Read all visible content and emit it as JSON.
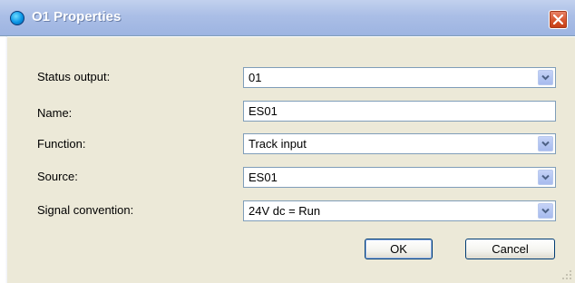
{
  "window": {
    "title": "O1 Properties",
    "icon": "blue-orb-icon",
    "close_icon": "close-icon"
  },
  "form": {
    "rows": [
      {
        "label": "Status output:",
        "value": "01",
        "control": "dropdown"
      },
      {
        "label": "Name:",
        "value": "ES01",
        "control": "textbox"
      },
      {
        "label": "Function:",
        "value": "Track input",
        "control": "dropdown"
      },
      {
        "label": "Source:",
        "value": "ES01",
        "control": "dropdown"
      },
      {
        "label": "Signal convention:",
        "value": "24V dc = Run",
        "control": "dropdown"
      }
    ]
  },
  "buttons": {
    "ok_label": "OK",
    "cancel_label": "Cancel"
  },
  "colors": {
    "titlebar": "#aabee6",
    "client_background": "#ece9d8",
    "field_border": "#7f9db9",
    "close_button": "#d7562f"
  }
}
